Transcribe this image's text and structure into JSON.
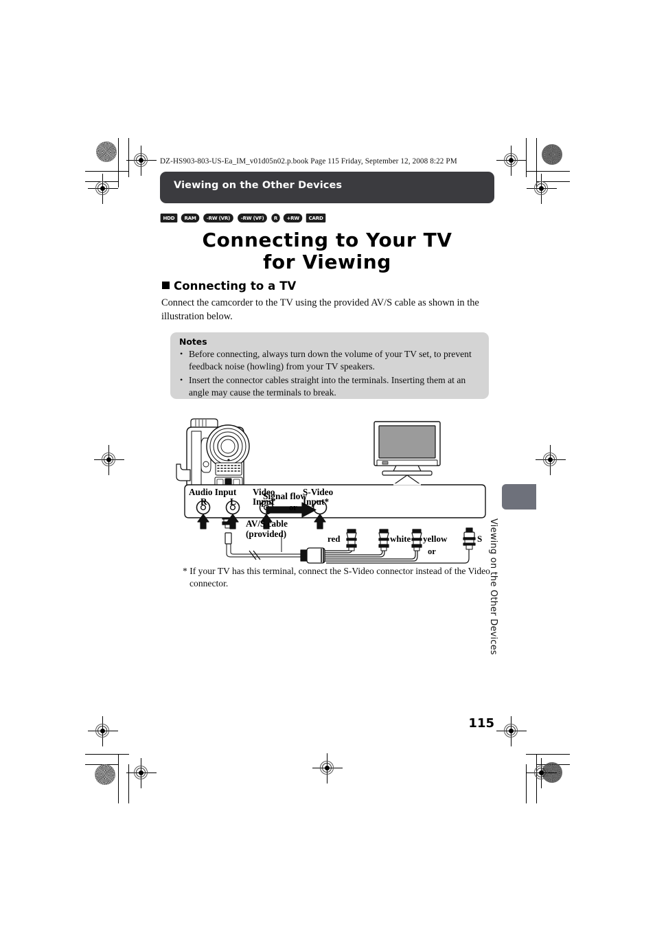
{
  "print_marks": {
    "description": "printer registration crosshairs, crop lines and halftone density dots"
  },
  "header": {
    "file_stamp": "DZ-HS903-803-US-Ea_IM_v01d05n02.p.book  Page 115  Friday, September 12, 2008  8:22 PM",
    "chapter_label": "Viewing on the Other Devices"
  },
  "media_badges": [
    {
      "label": "HDD",
      "shape": "rect"
    },
    {
      "label": "RAM",
      "shape": "pill"
    },
    {
      "label": "-RW (VR)",
      "shape": "pill"
    },
    {
      "label": "-RW (VF)",
      "shape": "pill"
    },
    {
      "label": "R",
      "shape": "circle"
    },
    {
      "label": "+RW",
      "shape": "pill"
    },
    {
      "label": "CARD",
      "shape": "rect"
    }
  ],
  "title": {
    "line1": "Connecting to Your TV",
    "line2": "for Viewing"
  },
  "section": {
    "heading": "Connecting to a TV",
    "intro": "Connect the camcorder to the TV using the provided AV/S cable as shown in the illustration below."
  },
  "notes": {
    "title": "Notes",
    "items": [
      "Before connecting, always turn down the volume of your TV set, to prevent feedback noise (howling) from your TV speakers.",
      "Insert the connector cables straight into the terminals. Inserting them at an angle may cause the terminals to break."
    ]
  },
  "illustration": {
    "signal_flow": "Signal flow",
    "cable_name": "AV/S cable",
    "cable_provided": "(provided)",
    "panel": {
      "audio_input": "Audio Input",
      "channel_r": "R",
      "channel_l": "L",
      "video_input_l1": "Video",
      "video_input_l2": "Input",
      "svideo_input_l1": "S-Video",
      "svideo_input_l2": "Input*",
      "or_top": "or"
    },
    "plugs": {
      "red": "red",
      "white": "white",
      "yellow": "yellow",
      "s": "S",
      "or_bottom": "or"
    }
  },
  "footnote": "* If your TV has this terminal, connect the S-Video connector instead of the Video connector.",
  "side_tab": {
    "text": "Viewing on the Other Devices"
  },
  "page_number": "115",
  "colors": {
    "chapter_bar": "#3b3b3f",
    "notes_box": "#d4d4d4",
    "side_tab": "#6e717b",
    "screen_gray": "#9b9b9b"
  }
}
